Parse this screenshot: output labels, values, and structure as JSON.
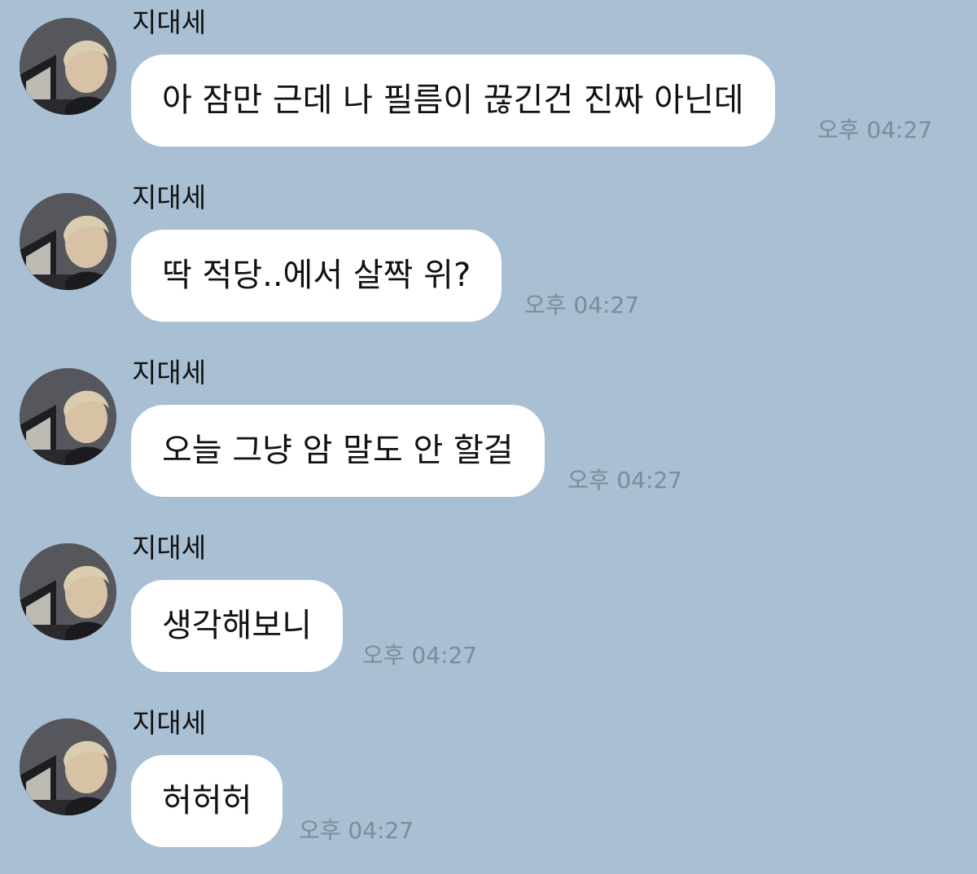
{
  "messages": [
    {
      "sender": "지대세",
      "text": "아 잠만 근데 나 필름이 끊긴건 진짜 아닌데",
      "time": "오후 04:27"
    },
    {
      "sender": "지대세",
      "text": "딱 적당..에서 살짝 위?",
      "time": "오후 04:27"
    },
    {
      "sender": "지대세",
      "text": "오늘 그냥 암 말도 안 할걸",
      "time": "오후 04:27"
    },
    {
      "sender": "지대세",
      "text": "생각해보니",
      "time": "오후 04:27"
    },
    {
      "sender": "지대세",
      "text": "허허허",
      "time": "오후 04:27"
    }
  ],
  "icons": {
    "avatar": "profile-photo"
  },
  "colors": {
    "background": "#a9bfd3",
    "bubble": "#ffffff",
    "timestamp": "#7f8a96"
  }
}
